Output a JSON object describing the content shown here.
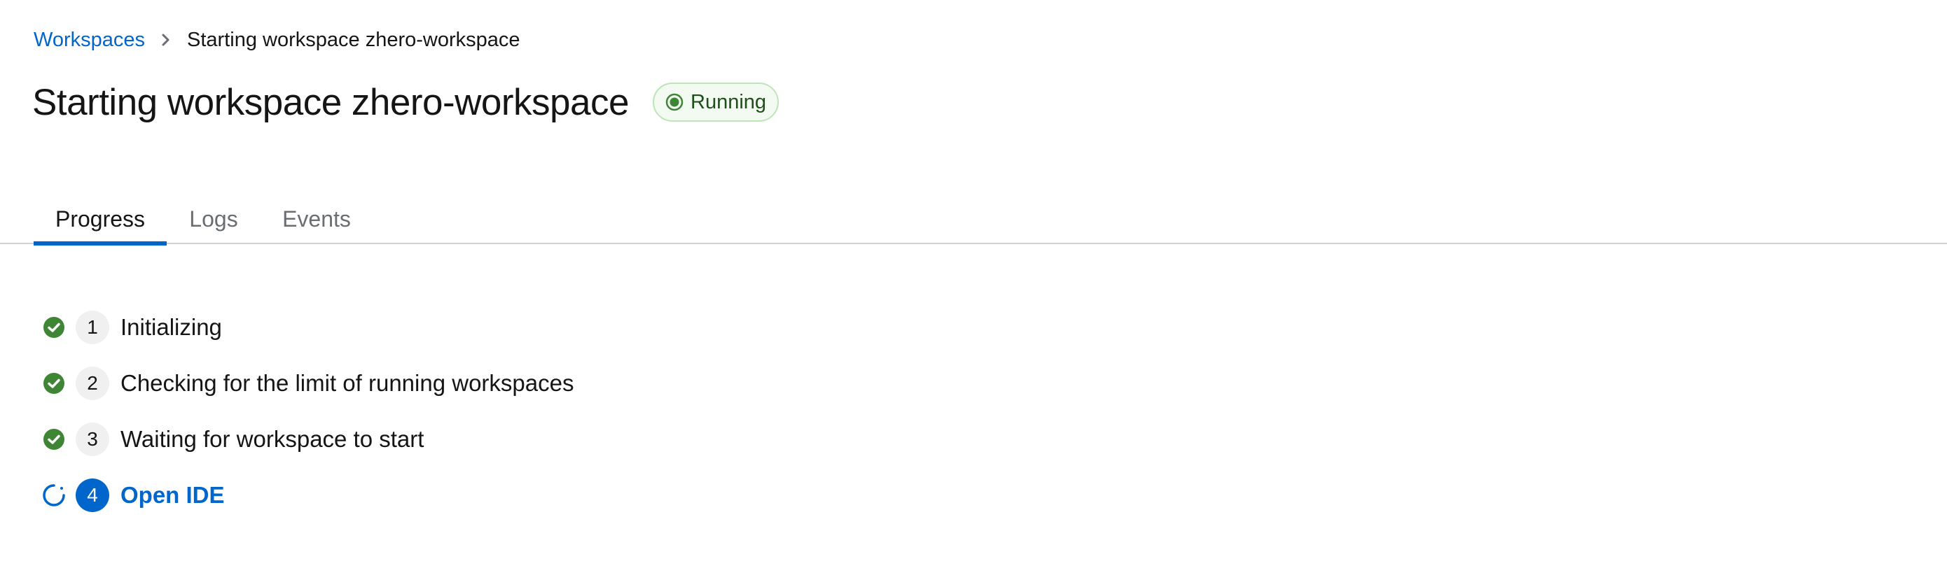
{
  "breadcrumb": {
    "root_label": "Workspaces",
    "current_label": "Starting workspace zhero-workspace"
  },
  "header": {
    "title": "Starting workspace zhero-workspace",
    "status_label": "Running",
    "status_color": "#3e8635"
  },
  "tabs": [
    {
      "label": "Progress",
      "active": true
    },
    {
      "label": "Logs",
      "active": false
    },
    {
      "label": "Events",
      "active": false
    }
  ],
  "steps": [
    {
      "number": "1",
      "label": "Initializing",
      "state": "done",
      "icon": "check-circle-icon"
    },
    {
      "number": "2",
      "label": "Checking for the limit of running workspaces",
      "state": "done",
      "icon": "check-circle-icon"
    },
    {
      "number": "3",
      "label": "Waiting for workspace to start",
      "state": "done",
      "icon": "check-circle-icon"
    },
    {
      "number": "4",
      "label": "Open IDE",
      "state": "in-progress",
      "icon": "spinner-icon"
    }
  ],
  "colors": {
    "accent": "#0066cc",
    "success": "#3e8635"
  }
}
